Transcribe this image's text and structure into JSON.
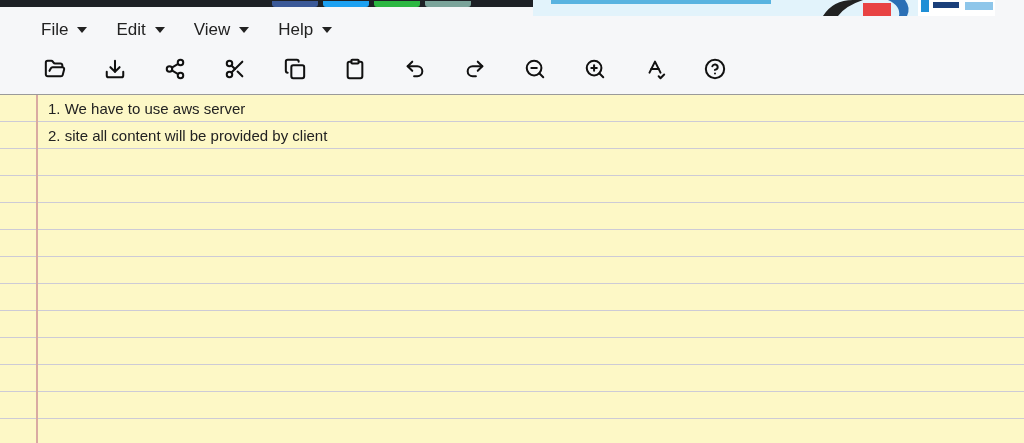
{
  "menu": [
    {
      "label": "File"
    },
    {
      "label": "Edit"
    },
    {
      "label": "View"
    },
    {
      "label": "Help"
    }
  ],
  "notepad": {
    "lines": [
      "1. We have to use aws server",
      "2. site all content will be provided by client"
    ]
  }
}
